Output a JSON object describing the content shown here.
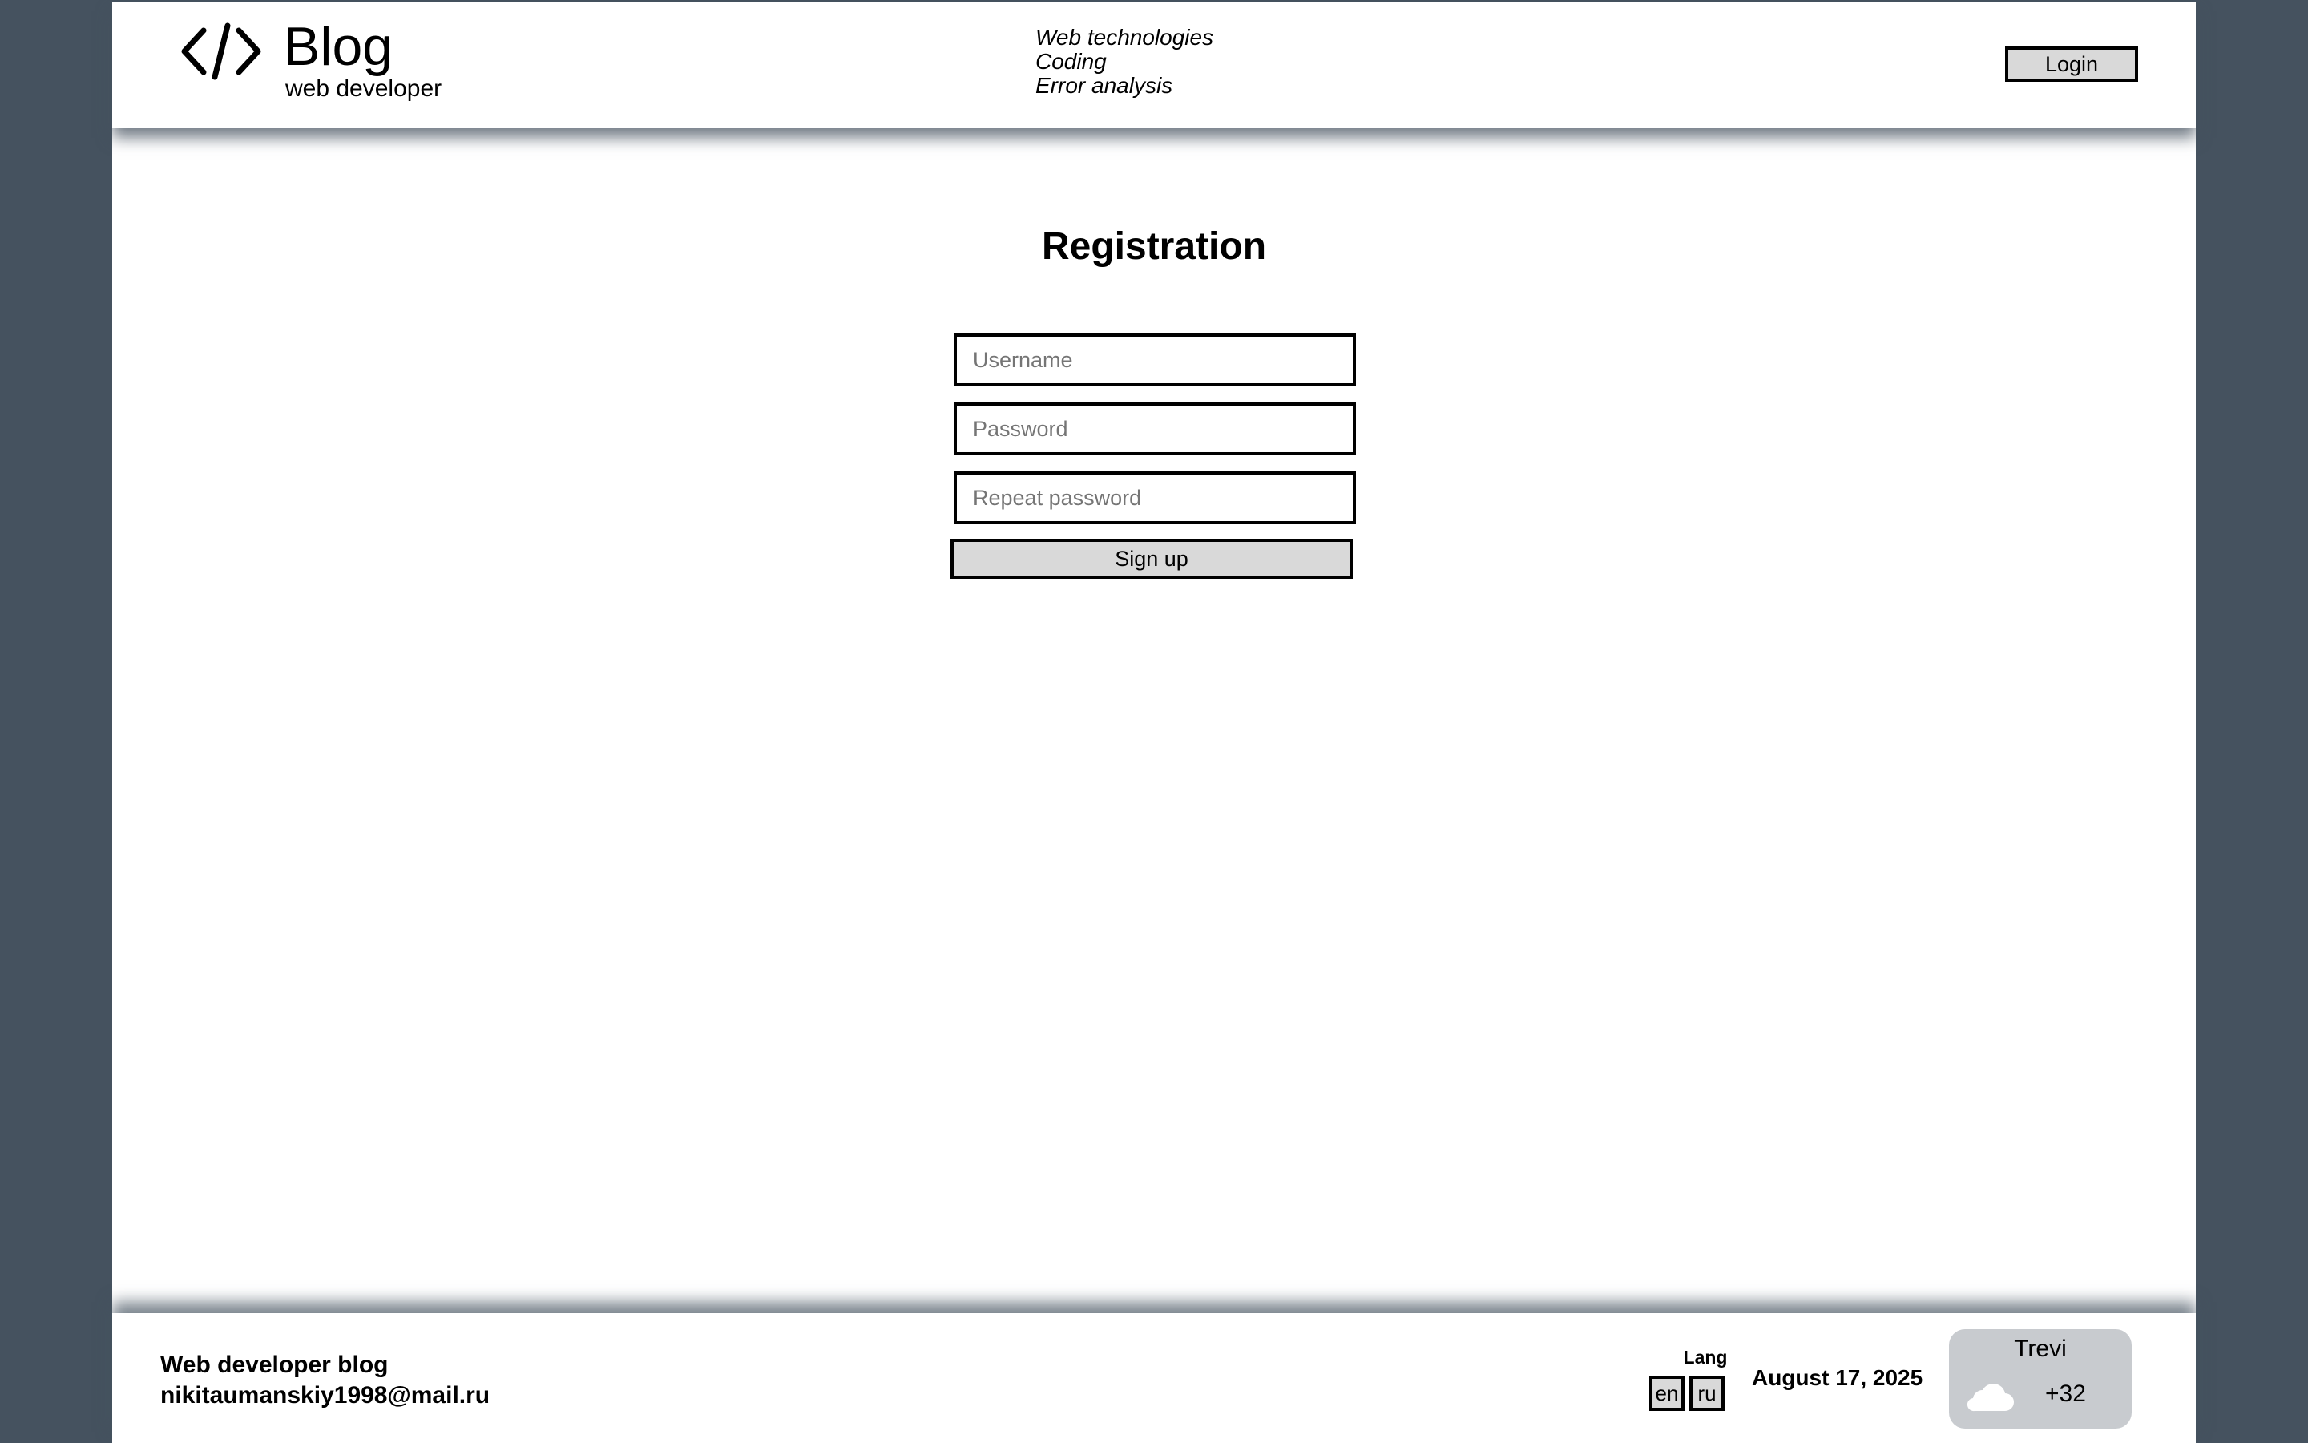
{
  "header": {
    "brand_title": "Blog",
    "brand_subtitle": "web developer",
    "nav": [
      "Web technologies",
      "Coding",
      "Error analysis"
    ],
    "login_label": "Login",
    "logo_icon": "code-brackets-icon"
  },
  "main": {
    "title": "Registration",
    "fields": {
      "username_placeholder": "Username",
      "password_placeholder": "Password",
      "repeat_password_placeholder": "Repeat password"
    },
    "signup_label": "Sign up"
  },
  "footer": {
    "title": "Web developer blog",
    "email": "nikitaumanskiy1998@mail.ru",
    "lang_label": "Lang",
    "lang_options": [
      "en",
      "ru"
    ],
    "date": "August 17, 2025",
    "weather": {
      "city": "Trevi",
      "temperature": "+32",
      "icon": "cloud-icon"
    }
  },
  "colors": {
    "background": "#45525f",
    "page": "#ffffff",
    "button": "#d9d9d9",
    "weather_card": "#c8cbcf"
  }
}
